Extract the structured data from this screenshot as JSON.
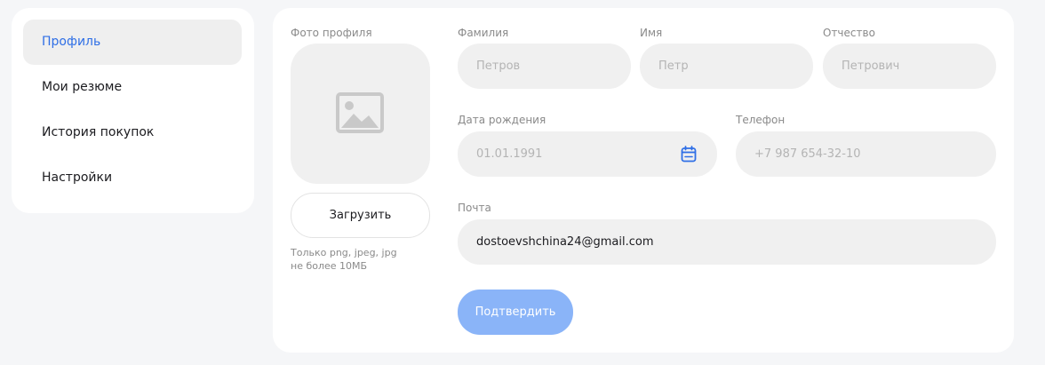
{
  "sidebar": {
    "items": [
      {
        "label": "Профиль",
        "active": true
      },
      {
        "label": "Мои резюме"
      },
      {
        "label": "История покупок"
      },
      {
        "label": "Настройки"
      }
    ]
  },
  "profile": {
    "photo_label": "Фото профиля",
    "photo_icon": "image-placeholder-icon",
    "upload_label": "Загрузить",
    "upload_hint_line1": "Только png, jpeg, jpg",
    "upload_hint_line2": "не более 10МБ",
    "last_name": {
      "label": "Фамилия",
      "placeholder": "Петров",
      "value": ""
    },
    "first_name": {
      "label": "Имя",
      "placeholder": "Петр",
      "value": ""
    },
    "patronymic": {
      "label": "Отчество",
      "placeholder": "Петрович",
      "value": ""
    },
    "birth_date": {
      "label": "Дата рождения",
      "placeholder": "01.01.1991",
      "value": "",
      "icon": "calendar-icon"
    },
    "phone": {
      "label": "Телефон",
      "placeholder": "+7 987 654-32-10",
      "value": ""
    },
    "email": {
      "label": "Почта",
      "placeholder": "",
      "value": "dostoevshchina24@gmail.com"
    },
    "submit_label": "Подтвердить"
  },
  "colors": {
    "accent": "#2f6fe6",
    "submit_disabled": "#8ab4f8",
    "field_bg": "#f0f0f0",
    "page_bg": "#f5f6f8"
  }
}
